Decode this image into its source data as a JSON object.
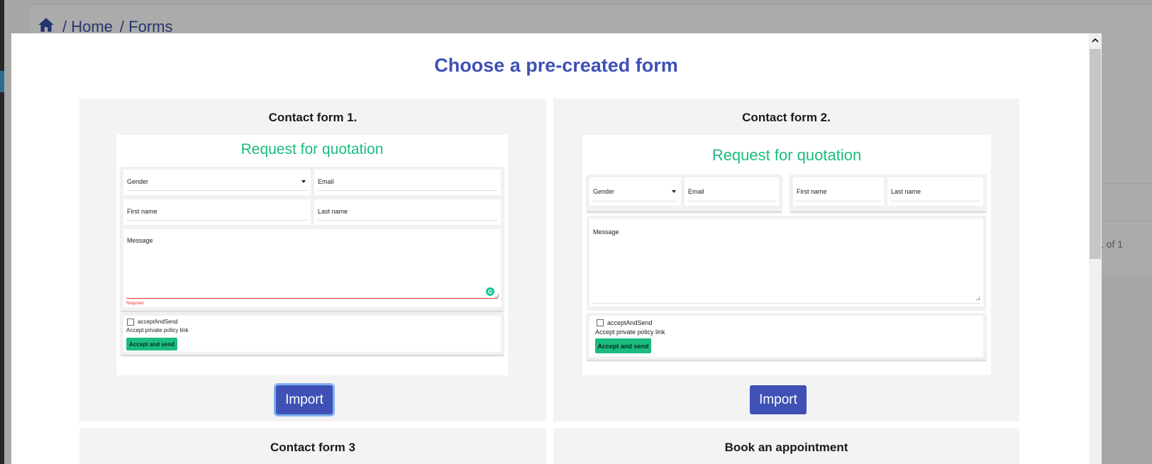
{
  "background": {
    "breadcrumb": [
      "/ Home",
      "/ Forms"
    ],
    "pagination": "1 of 1"
  },
  "modal": {
    "title": "Choose a pre-created form",
    "cards": [
      {
        "title": "Contact form 1.",
        "preview": {
          "heading": "Request for quotation",
          "gender": "Gender",
          "email": "Email",
          "first_name": "First name",
          "last_name": "Last name",
          "message": "Message",
          "error": "Required",
          "checkbox": "acceptAndSend",
          "policy": "Accept private policy link",
          "button": "Accept and send"
        },
        "import": "Import"
      },
      {
        "title": "Contact form 2.",
        "preview": {
          "heading": "Request for quotation",
          "gender": "Gender",
          "email": "Email",
          "first_name": "First name",
          "last_name": "Last name",
          "message": "Message",
          "checkbox": "acceptAndSend",
          "policy": "Accept private policy link",
          "button": "Accept and send"
        },
        "import": "Import"
      },
      {
        "title": "Contact form 3"
      },
      {
        "title": "Book an appointment"
      }
    ]
  },
  "colors": {
    "accent": "#3f51b5",
    "brand_green": "#1bbc7e",
    "error": "#e53935",
    "overlay": "#a7a7a7"
  },
  "icons": [
    "home-icon",
    "chevron-up-icon",
    "caret-down-icon",
    "checkbox-icon",
    "grammarly-icon",
    "resize-icon"
  ]
}
